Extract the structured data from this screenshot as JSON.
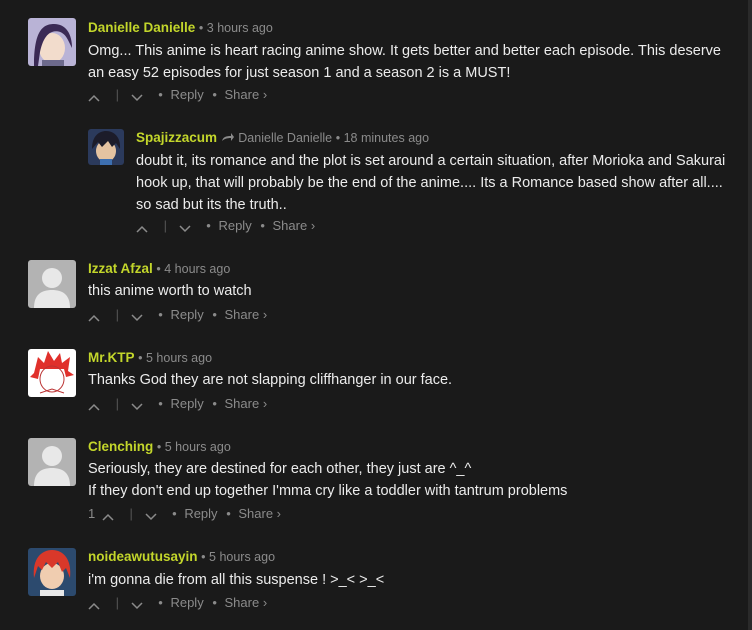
{
  "comments": [
    {
      "author": "Danielle Danielle",
      "time": "3 hours ago",
      "lines": [
        "Omg... This anime is heart racing anime show. It gets better and better each episode. This deserve",
        "an easy 52 episodes for just season 1 and a season 2 is a MUST!"
      ],
      "votes": "",
      "reply": "Reply",
      "share": "Share ›"
    },
    {
      "author": "Spajizzacum",
      "reply_to": "Danielle Danielle",
      "time": "18 minutes ago",
      "lines": [
        "doubt it, its romance and the plot is set around a certain situation, after Morioka and Sakurai",
        "hook up, that will probably be the end of the anime.... Its a Romance based show after all....",
        "so sad but its the truth.."
      ],
      "votes": "",
      "reply": "Reply",
      "share": "Share ›"
    },
    {
      "author": "Izzat Afzal",
      "time": "4 hours ago",
      "lines": [
        "this anime worth to watch"
      ],
      "votes": "",
      "reply": "Reply",
      "share": "Share ›"
    },
    {
      "author": "Mr.KTP",
      "time": "5 hours ago",
      "lines": [
        "Thanks God they are not slapping cliffhanger in our face."
      ],
      "votes": "",
      "reply": "Reply",
      "share": "Share ›"
    },
    {
      "author": "Clenching",
      "time": "5 hours ago",
      "lines": [
        "Seriously, they are destined for each other, they just are ^_^",
        "If they don't end up together I'mma cry like a toddler with tantrum problems"
      ],
      "votes": "1",
      "reply": "Reply",
      "share": "Share ›"
    },
    {
      "author": "noideawutusayin",
      "time": "5 hours ago",
      "lines": [
        "i'm gonna die from all this suspense ! >_< >_<"
      ],
      "votes": "",
      "reply": "Reply",
      "share": "Share ›"
    }
  ],
  "colors": {
    "author": "#c3d62b",
    "meta": "#8b8b8b",
    "background": "#1a1a1a"
  },
  "icons": {
    "upvote": "chevron-up-icon",
    "downvote": "chevron-down-icon",
    "reply_arrow": "reply-arrow-icon"
  }
}
